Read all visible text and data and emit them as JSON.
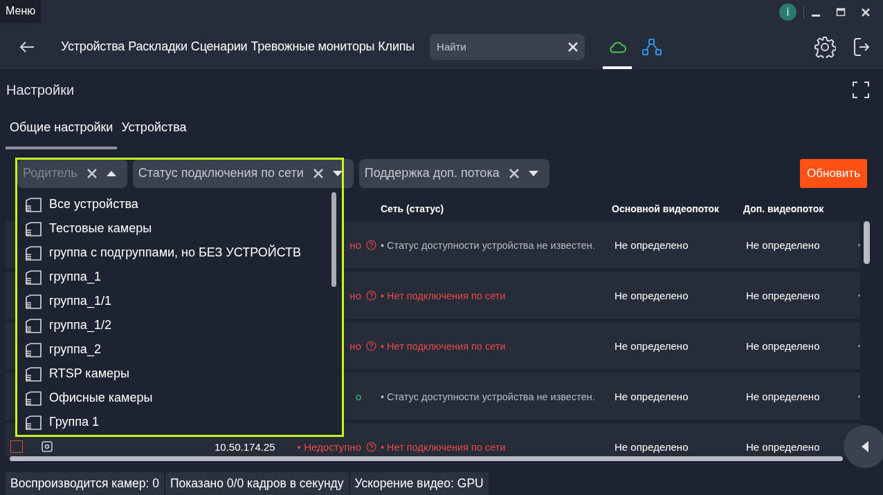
{
  "titlebar": {
    "menu": "Меню",
    "info": "i"
  },
  "nav": {
    "links": [
      "Устройства",
      "Раскладки",
      "Сценарии",
      "Тревожные мониторы",
      "Клипы"
    ],
    "search": {
      "placeholder": "Найти"
    },
    "views": [
      {
        "kind": "cloud",
        "selected": true
      },
      {
        "kind": "network",
        "selected": false
      }
    ]
  },
  "page": {
    "title": "Настройки"
  },
  "tabs": [
    {
      "label": "Общие настройки",
      "selected": true
    },
    {
      "label": "Устройства",
      "selected": false
    }
  ],
  "filters": [
    {
      "label": "Родитель",
      "expanded": true
    },
    {
      "label": "Статус подключения по сети",
      "expanded": false
    },
    {
      "label": "Поддержка доп. потока",
      "expanded": false
    }
  ],
  "refresh_button": "Обновить",
  "parent_dropdown": {
    "items": [
      "Все устройства",
      "Тестовые камеры",
      "группа с подгруппами, но БЕЗ УСТРОЙСТВ",
      "группа_1",
      "группа_1/1",
      "группа_1/2",
      "группа_2",
      "RTSP камеры",
      "Офисные камеры",
      "Группа 1"
    ]
  },
  "table": {
    "columns": [
      "Сеть (статус)",
      "Основной видеопоток",
      "Доп. видеопоток"
    ],
    "rows": [
      {
        "availability": {
          "text": "но",
          "color": "#e8484b",
          "help": true
        },
        "network": {
          "text": "• Статус доступности устройства не известен.",
          "color": "#b8bcc4"
        },
        "main_stream": "Не определено",
        "extra_stream": "Не определено"
      },
      {
        "availability": {
          "text": "но",
          "color": "#e8484b",
          "help": true
        },
        "network": {
          "text": "• Нет подключения по сети",
          "color": "#e8484b"
        },
        "main_stream": "Не определено",
        "extra_stream": "Не определено"
      },
      {
        "availability": {
          "text": "но",
          "color": "#e8484b",
          "help": true
        },
        "network": {
          "text": "• Нет подключения по сети",
          "color": "#e8484b"
        },
        "main_stream": "Не определено",
        "extra_stream": "Не определено"
      },
      {
        "availability": {
          "text": "о",
          "color": "#2ec27e",
          "help": false
        },
        "network": {
          "text": "• Статус доступности устройства не известен.",
          "color": "#b8bcc4"
        },
        "main_stream": "Не определено",
        "extra_stream": "Не определено"
      },
      {
        "checked": false,
        "address": "10.50.174.25",
        "availability": {
          "text": "• Недоступно",
          "color": "#e8484b",
          "help": true
        },
        "network": {
          "text": "• Нет подключения по сети",
          "color": "#e8484b"
        },
        "main_stream": "Не определено",
        "extra_stream": "Не определено"
      }
    ]
  },
  "status_bar": [
    "Воспроизводится камер: 0",
    "Показано 0/0 кадров в секунду",
    "Ускорение видео: GPU"
  ]
}
